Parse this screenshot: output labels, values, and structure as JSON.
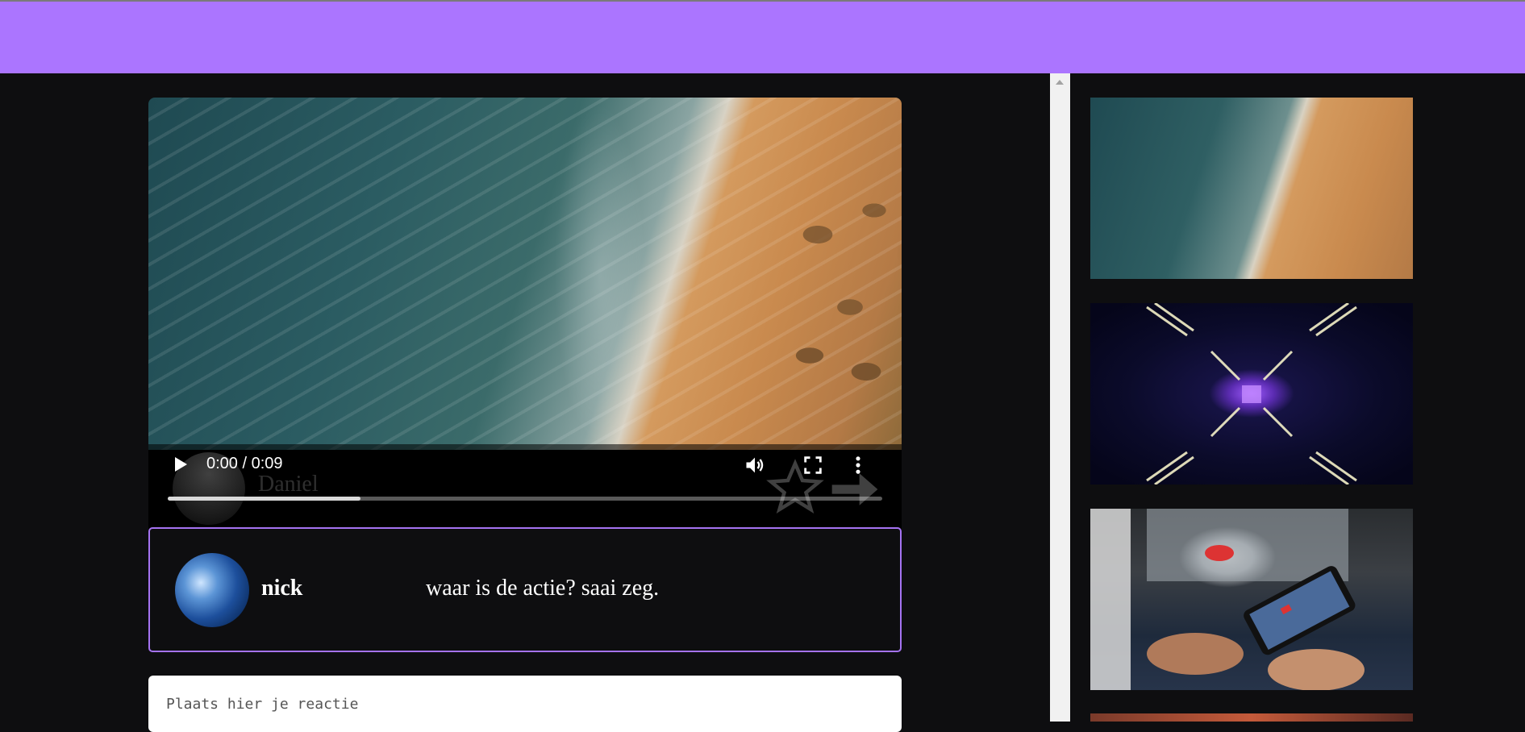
{
  "header": {
    "color": "#ab75ff"
  },
  "player": {
    "current_time": "0:00",
    "duration": "0:09",
    "time_separator": " / ",
    "progress_fraction": 0.27,
    "watermark_name": "Daniel"
  },
  "comment": {
    "username": "nick",
    "text": "waar is de actie? saai zeg."
  },
  "reply": {
    "placeholder": "Plaats hier je reactie"
  },
  "sidebar": {
    "videos": [
      {
        "name": "beach-aerial"
      },
      {
        "name": "neon-tunnel"
      },
      {
        "name": "mobile-gaming"
      }
    ]
  },
  "colors": {
    "accent": "#ab75ff",
    "background": "#0e0e10",
    "card_border": "#a573f2"
  }
}
